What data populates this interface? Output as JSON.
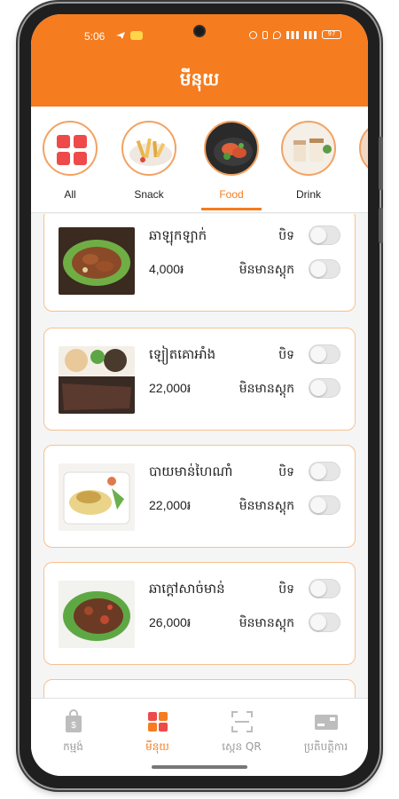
{
  "status_bar": {
    "time": "5:06",
    "battery": "97"
  },
  "header": {
    "title": "មីនុយ"
  },
  "categories": [
    {
      "label": "All",
      "icon": "grid-icon",
      "active": false
    },
    {
      "label": "Snack",
      "icon": "snack-photo",
      "active": false
    },
    {
      "label": "Food",
      "icon": "food-photo",
      "active": true
    },
    {
      "label": "Drink",
      "icon": "drink-photo",
      "active": false
    }
  ],
  "items": [
    {
      "name": "ឆាឡុកឡាក់",
      "price": "4,000៛",
      "toggle1_label": "បិទ",
      "toggle2_label": "មិនមានស្តុក",
      "toggle1_on": false,
      "toggle2_on": false
    },
    {
      "name": "ឡៀតគោអាំង",
      "price": "22,000៛",
      "toggle1_label": "បិទ",
      "toggle2_label": "មិនមានស្តុក",
      "toggle1_on": false,
      "toggle2_on": false
    },
    {
      "name": "បាយមាន់ហៃណាំ",
      "price": "22,000៛",
      "toggle1_label": "បិទ",
      "toggle2_label": "មិនមានស្តុក",
      "toggle1_on": false,
      "toggle2_on": false
    },
    {
      "name": "ឆាក្តៅសាច់មាន់",
      "price": "26,000៛",
      "toggle1_label": "បិទ",
      "toggle2_label": "មិនមានស្តុក",
      "toggle1_on": false,
      "toggle2_on": false
    }
  ],
  "bottom_nav": [
    {
      "label": "កម្មង់",
      "icon": "shopping-bag-icon",
      "active": false
    },
    {
      "label": "មីនុយ",
      "icon": "menu-grid-icon",
      "active": true
    },
    {
      "label": "ស្កេន QR",
      "icon": "qr-scan-icon",
      "active": false
    },
    {
      "label": "ប្រតិបត្តិការ",
      "icon": "card-icon",
      "active": false
    }
  ],
  "colors": {
    "accent": "#f57c1f",
    "card_border": "#f6c08e",
    "grid_red": "#ee4a4a"
  }
}
